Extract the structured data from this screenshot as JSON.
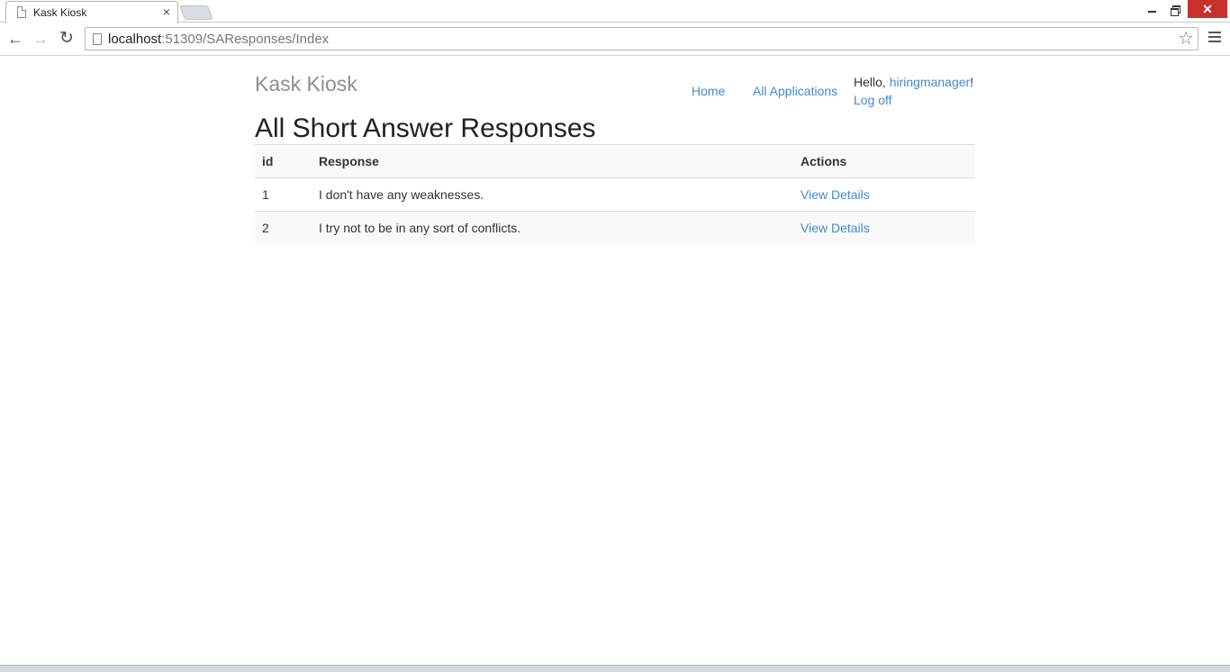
{
  "browser": {
    "tab_title": "Kask Kiosk",
    "tab_close": "×",
    "url_host": "localhost",
    "url_rest": ":51309/SAResponses/Index",
    "window_close": "✕"
  },
  "nav": {
    "brand": "Kask Kiosk",
    "home": "Home",
    "all_applications": "All Applications",
    "hello_prefix": "Hello, ",
    "username": "hiringmanager",
    "hello_suffix": "!",
    "log_off": "Log off"
  },
  "page": {
    "title": "All Short Answer Responses"
  },
  "table": {
    "headers": [
      "id",
      "Response",
      "Actions"
    ],
    "rows": [
      {
        "id": "1",
        "response": "I don't have any weaknesses.",
        "action": "View Details"
      },
      {
        "id": "2",
        "response": "I try not to be in any sort of conflicts.",
        "action": "View Details"
      }
    ]
  },
  "colors": {
    "link": "#428bca",
    "brand": "#8e8e8e",
    "close": "#c7312b"
  }
}
